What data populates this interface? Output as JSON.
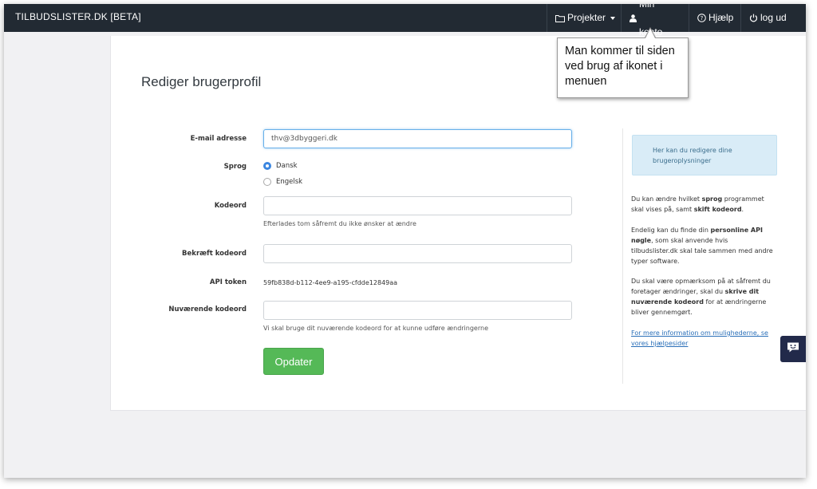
{
  "navbar": {
    "brand": "TILBUDSLISTER.DK [BETA]",
    "projekter": "Projekter",
    "min_konto": "Min konto",
    "hjaelp": "Hjælp",
    "log_ud": "log ud",
    "bg_color": "#222a33"
  },
  "callout": {
    "text": "Man kommer til siden ved brug af ikonet i menuen"
  },
  "page": {
    "title": "Rediger brugerprofil"
  },
  "form": {
    "email_label": "E-mail adresse",
    "email_value": "thv@3dbyggeri.dk",
    "sprog_label": "Sprog",
    "sprog_options": [
      "Dansk",
      "Engelsk"
    ],
    "sprog_selected": "Dansk",
    "kodeord_label": "Kodeord",
    "kodeord_help": "Efterlades tom såfremt du ikke ønsker at ændre",
    "bekraeft_label": "Bekræft kodeord",
    "api_label": "API token",
    "api_value": "59fb838d-b112-4ee9-a195-cfdde12849aa",
    "nuvaerende_label": "Nuværende kodeord",
    "nuvaerende_help": "Vi skal bruge dit nuværende kodeord for at kunne udføre ændringerne",
    "submit_label": "Opdater",
    "submit_color": "#55b957"
  },
  "sidebar": {
    "info_box": "Her kan du redigere dine brugeroplysninger",
    "p1_a": "Du kan ændre hvilket ",
    "p1_b": "sprog",
    "p1_c": " programmet skal vises på, samt ",
    "p1_d": "skift kodeord",
    "p1_e": ".",
    "p2_a": "Endelig kan du finde din ",
    "p2_b": "personline API nøgle",
    "p2_c": ", som skal anvende hvis tilbudslister.dk skal tale sammen med andre typer software.",
    "p3_a": "Du skal være opmærksom på at såfremt du foretager ændringer, skal du ",
    "p3_b": "skrive dit nuværende kodeord",
    "p3_c": " for at ændringerne bliver gennemgørt.",
    "link": "For mere information om mulighederne, se vores hjælpesider"
  },
  "icons": {
    "folder": "folder-icon",
    "user": "user-icon",
    "help": "question-circle-icon",
    "power": "power-icon",
    "chat": "chat-icon"
  }
}
